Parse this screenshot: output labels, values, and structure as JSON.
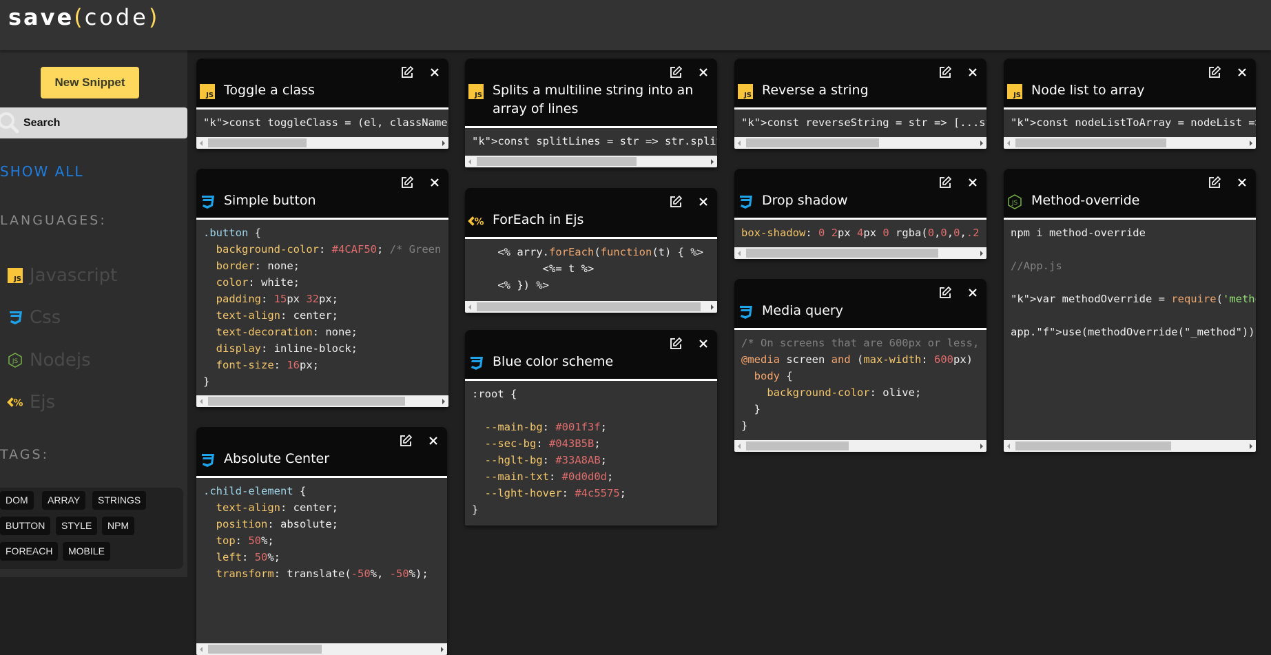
{
  "app": {
    "logo_prefix": "save",
    "logo_open": "(",
    "logo_word": "code",
    "logo_close": ")",
    "accent_color": "#fdd85d"
  },
  "sidebar": {
    "new_snippet_label": "New Snippet",
    "search_placeholder": "Search",
    "show_all_label": "SHOW ALL",
    "languages_heading": "LANGUAGES:",
    "languages": [
      {
        "label": "Javascript",
        "icon": "js-icon"
      },
      {
        "label": "Css",
        "icon": "css-icon"
      },
      {
        "label": "Nodejs",
        "icon": "nodejs-icon"
      },
      {
        "label": "Ejs",
        "icon": "ejs-icon"
      }
    ],
    "tags_heading": "TAGS:",
    "tags": [
      "DOM",
      "ARRAY",
      "STRINGS",
      "BUTTON",
      "STYLE",
      "NPM",
      "FOREACH",
      "MOBILE"
    ]
  },
  "snippets": [
    {
      "title": "Toggle a class",
      "lang": "js",
      "code": "const toggleClass = (el, className) ="
    },
    {
      "title": "Simple button",
      "lang": "css",
      "code": ".button {\n  background-color: #4CAF50; /* Green\n  border: none;\n  color: white;\n  padding: 15px 32px;\n  text-align: center;\n  text-decoration: none;\n  display: inline-block;\n  font-size: 16px;\n}"
    },
    {
      "title": "Absolute Center",
      "lang": "css",
      "code": ".child-element {\n  text-align: center;\n  position: absolute;\n  top: 50%;\n  left: 50%;\n  transform: translate(-50%, -50%);"
    },
    {
      "title": "Splits a multiline string into an array of lines",
      "lang": "js",
      "code": "const splitLines = str => str.split(/"
    },
    {
      "title": "ForEach in Ejs",
      "lang": "ejs",
      "code": "    <% arry.forEach(function(t) { %>\n           <%= t %>\n    <% }) %>"
    },
    {
      "title": "Blue color scheme",
      "lang": "css",
      "code": ":root {\n\n  --main-bg: #001f3f;\n  --sec-bg: #043B5B;\n  --hglt-bg: #33A8AB;\n  --main-txt: #0d0d0d;\n  --lght-hover: #4c5575;\n}"
    },
    {
      "title": "Reverse a string",
      "lang": "js",
      "code": "const reverseString = str => [...str]"
    },
    {
      "title": "Drop shadow",
      "lang": "css",
      "code": "box-shadow: 0 2px 4px 0 rgba(0,0,0,.2"
    },
    {
      "title": "Media query",
      "lang": "css",
      "code": "/* On screens that are 600px or less,\n@media screen and (max-width: 600px)\n  body {\n    background-color: olive;\n  }\n}"
    },
    {
      "title": "Node list to array",
      "lang": "js",
      "code": "const nodeListToArray = nodeList => ["
    },
    {
      "title": "Method-override",
      "lang": "nodejs",
      "code": "npm i method-override\n\n//App.js\n\nvar methodOverride = require('method-\n\napp.use(methodOverride(\"_method\"));"
    }
  ]
}
